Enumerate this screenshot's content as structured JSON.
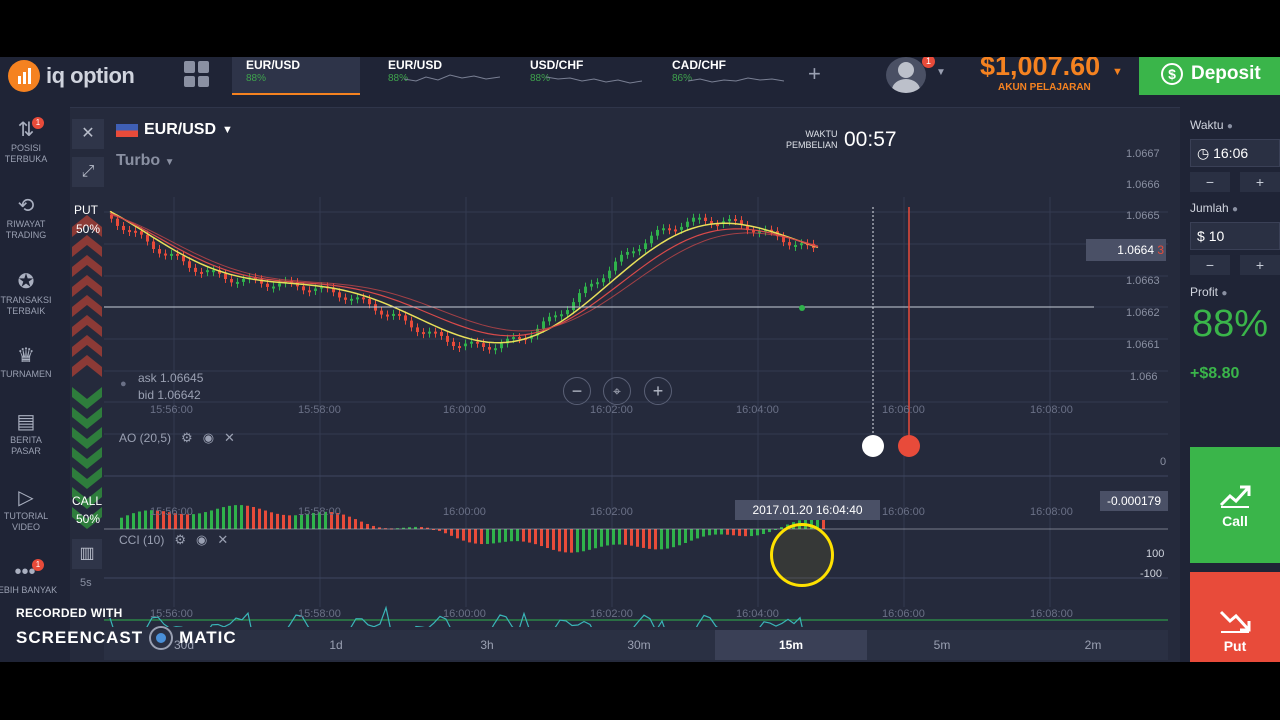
{
  "topbar": {
    "logo_text": "iq option",
    "tabs": [
      {
        "symbol": "EUR/USD",
        "payout": "88%"
      },
      {
        "symbol": "EUR/USD",
        "payout": "88%"
      },
      {
        "symbol": "USD/CHF",
        "payout": "88%"
      },
      {
        "symbol": "CAD/CHF",
        "payout": "86%"
      }
    ],
    "add_tab": "+",
    "notification_count": "1",
    "balance": "$1,007.60",
    "account_label": "AKUN PELAJARAN",
    "deposit_label": "Deposit"
  },
  "sidebar": {
    "items": [
      {
        "icon": "open-positions-icon",
        "label": "POSISI TERBUKA",
        "badge": "1"
      },
      {
        "icon": "history-icon",
        "label": "RIWAYAT TRADING"
      },
      {
        "icon": "best-trades-icon",
        "label": "TRANSAKSI TERBAIK"
      },
      {
        "icon": "trophy-icon",
        "label": "TURNAMEN"
      },
      {
        "icon": "news-icon",
        "label": "BERITA PASAR"
      },
      {
        "icon": "play-icon",
        "label": "TUTORIAL VIDEO"
      },
      {
        "icon": "more-icon",
        "label": "LEBIH BANYAK",
        "badge": "1"
      }
    ]
  },
  "chart": {
    "pair": "EUR/USD",
    "mode": "Turbo",
    "put_label": "PUT",
    "put_pct": "50%",
    "call_label": "CALL",
    "call_pct": "50%",
    "timer_label_1": "WAKTU",
    "timer_label_2": "PEMBELIAN",
    "timer": "00:57",
    "ask": "ask 1.06645",
    "bid": "bid 1.06642",
    "current_price": "1.06643",
    "current_price_main": "1.0664",
    "current_price_last": "3",
    "price_ticks": [
      "1.0667",
      "1.0666",
      "1.0665",
      "1.0664",
      "1.0663",
      "1.0662",
      "1.0661",
      "1.066"
    ],
    "time_ticks": [
      "15:56:00",
      "15:58:00",
      "16:00:00",
      "16:02:00",
      "16:04:00",
      "16:06:00",
      "16:08:00"
    ],
    "zoom_out": "−",
    "zoom_in": "+",
    "ao_label": "AO (20,5)",
    "ao_zero": "0",
    "ao_value": "-0.000179",
    "cci_label": "CCI (10)",
    "cci_upper": "100",
    "cci_lower": "-100",
    "crosshair_time": "2017.01.20 16:04:40",
    "chart_type_label": "5s",
    "colors": {
      "up": "#2fb24b",
      "down": "#e84b3a",
      "ma_fast": "#e8e05a",
      "ma_slow": "#d94a4a",
      "cci": "#3ab5b8",
      "accent": "#f58220"
    }
  },
  "timeframes": {
    "items": [
      "30d",
      "1d",
      "3h",
      "30m",
      "15m",
      "5m",
      "2m"
    ],
    "active": "15m"
  },
  "right_panel": {
    "time_label": "Waktu",
    "time_value": "16:06",
    "amount_label": "Jumlah",
    "amount_currency": "$",
    "amount_value": "10",
    "minus": "−",
    "plus": "+",
    "profit_label": "Profit",
    "profit_pct": "88%",
    "profit_amount": "+$8.80",
    "call_label": "Call",
    "put_label": "Put"
  },
  "watermark": {
    "line1": "RECORDED WITH",
    "line2a": "SCREENCAST",
    "line2b": "MATIC"
  }
}
